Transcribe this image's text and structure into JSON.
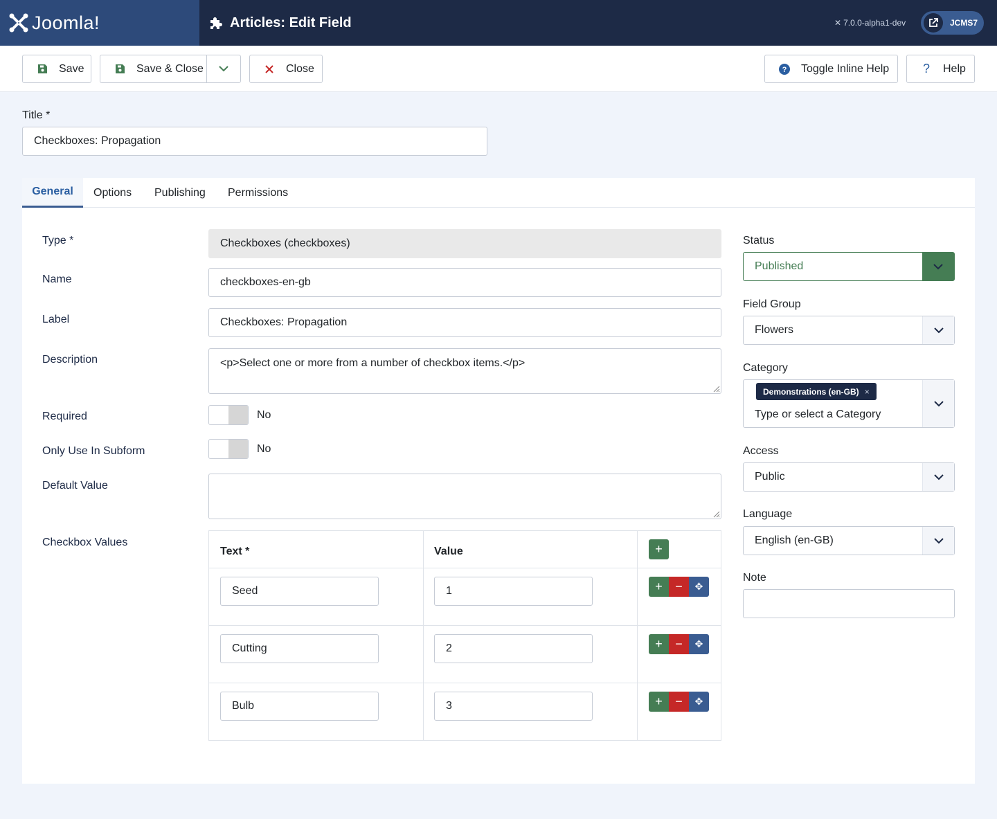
{
  "header": {
    "brand_name": "Joomla!",
    "page_title": "Articles: Edit Field",
    "version": "7.0.0-alpha1-dev",
    "user": "JCMS7"
  },
  "toolbar": {
    "save_label": "Save",
    "save_close_label": "Save & Close",
    "close_label": "Close",
    "toggle_help_label": "Toggle Inline Help",
    "help_label": "Help"
  },
  "title": {
    "label": "Title *",
    "value": "Checkboxes: Propagation"
  },
  "tabs": [
    {
      "label": "General",
      "active": true
    },
    {
      "label": "Options",
      "active": false
    },
    {
      "label": "Publishing",
      "active": false
    },
    {
      "label": "Permissions",
      "active": false
    }
  ],
  "form": {
    "type_label": "Type *",
    "type_value": "Checkboxes (checkboxes)",
    "name_label": "Name",
    "name_value": "checkboxes-en-gb",
    "label_label": "Label",
    "label_value": "Checkboxes: Propagation",
    "description_label": "Description",
    "description_value": "<p>Select one or more from a number of checkbox items.</p>",
    "required_label": "Required",
    "required_value": "No",
    "subform_label": "Only Use In Subform",
    "subform_value": "No",
    "default_label": "Default Value",
    "default_value": "",
    "checkbox_values_label": "Checkbox Values"
  },
  "checkbox_table": {
    "col_text": "Text *",
    "col_value": "Value",
    "rows": [
      {
        "text": "Seed",
        "value": "1"
      },
      {
        "text": "Cutting",
        "value": "2"
      },
      {
        "text": "Bulb",
        "value": "3"
      }
    ]
  },
  "sidebar": {
    "status_label": "Status",
    "status_value": "Published",
    "field_group_label": "Field Group",
    "field_group_value": "Flowers",
    "category_label": "Category",
    "category_chip": "Demonstrations (en-GB)",
    "category_placeholder": "Type or select a Category",
    "access_label": "Access",
    "access_value": "Public",
    "language_label": "Language",
    "language_value": "English (en-GB)",
    "note_label": "Note",
    "note_value": ""
  },
  "colors": {
    "header_bg": "#1d2a46",
    "brand_bg": "#2d4a7a",
    "success": "#457d54",
    "danger": "#c52827",
    "primary": "#3a5c91"
  }
}
